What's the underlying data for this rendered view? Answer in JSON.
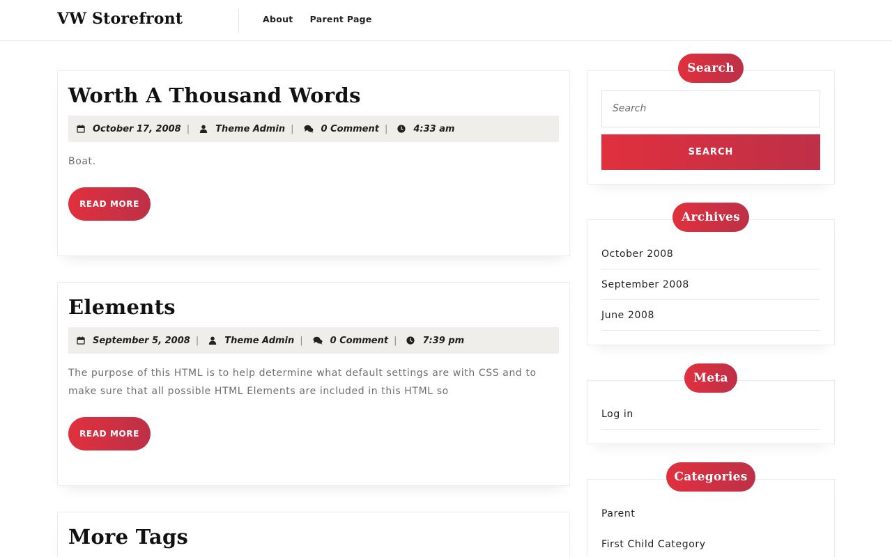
{
  "site": {
    "title": "VW Storefront"
  },
  "nav": {
    "items": [
      {
        "label": "About"
      },
      {
        "label": "Parent Page"
      }
    ]
  },
  "posts": [
    {
      "title": "Worth A Thousand Words",
      "date": "October 17, 2008",
      "author": "Theme Admin",
      "comments": "0 Comment",
      "time": "4:33 am",
      "excerpt": "Boat.",
      "read_more": "READ MORE"
    },
    {
      "title": "Elements",
      "date": "September 5, 2008",
      "author": "Theme Admin",
      "comments": "0 Comment",
      "time": "7:39 pm",
      "excerpt": "The purpose of this HTML is to help determine what default settings are with CSS and to make sure that all possible HTML Elements are included in this HTML so",
      "read_more": "READ MORE"
    },
    {
      "title": "More Tags"
    }
  ],
  "meta_separator": "|",
  "sidebar": {
    "search": {
      "title": "Search",
      "placeholder": "Search",
      "button": "SEARCH"
    },
    "archives": {
      "title": "Archives",
      "items": [
        {
          "label": "October 2008"
        },
        {
          "label": "September 2008"
        },
        {
          "label": "June 2008"
        }
      ]
    },
    "meta": {
      "title": "Meta",
      "items": [
        {
          "label": "Log in"
        }
      ]
    },
    "categories": {
      "title": "Categories",
      "items": [
        {
          "label": "Parent"
        },
        {
          "label": "First Child Category"
        }
      ]
    }
  },
  "colors": {
    "accent_start": "#e0303e",
    "accent_end": "#bd3047",
    "meta_bg": "#efeeea"
  },
  "icons": {
    "date": "calendar-icon",
    "author": "user-icon",
    "comments": "comments-icon",
    "time": "clock-icon"
  }
}
